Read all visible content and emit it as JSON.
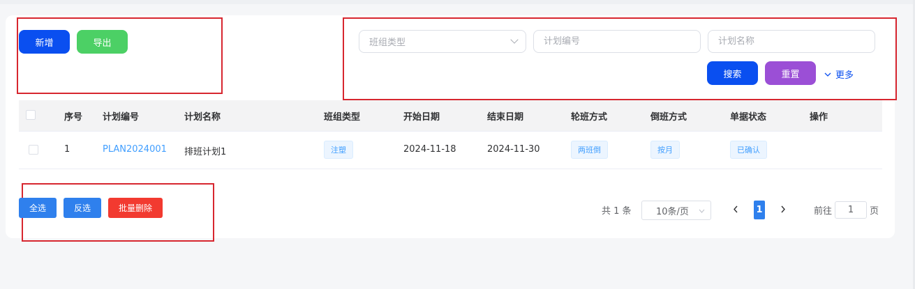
{
  "toolbar": {
    "add_label": "新增",
    "export_label": "导出"
  },
  "filters": {
    "team_type_placeholder": "班组类型",
    "plan_code_placeholder": "计划编号",
    "plan_name_placeholder": "计划名称",
    "search_label": "搜索",
    "reset_label": "重置",
    "more_label": "更多"
  },
  "table": {
    "headers": [
      "序号",
      "计划编号",
      "计划名称",
      "班组类型",
      "开始日期",
      "结束日期",
      "轮班方式",
      "倒班方式",
      "单据状态",
      "操作"
    ],
    "rows": [
      {
        "index": "1",
        "plan_code": "PLAN2024001",
        "plan_name": "排班计划1",
        "team_type": "注塑",
        "start_date": "2024-11-18",
        "end_date": "2024-11-30",
        "rotation": "两班倒",
        "shift_mode": "按月",
        "status": "已确认"
      }
    ]
  },
  "bulk": {
    "select_all": "全选",
    "invert": "反选",
    "batch_delete": "批量删除"
  },
  "pagination": {
    "total": "共 1 条",
    "page_size": "10条/页",
    "current_page": "1",
    "goto_label": "前往",
    "goto_value": "1",
    "page_suffix": "页"
  },
  "colors": {
    "primary": "#0a4ff0",
    "export": "#4cd065",
    "purple": "#9b4fd6",
    "blue": "#2f80ed",
    "danger": "#f23a30",
    "link": "#409eff"
  },
  "icons": {
    "caret": "chevron-down-icon",
    "prev": "chevron-left-icon",
    "next": "chevron-right-icon"
  }
}
